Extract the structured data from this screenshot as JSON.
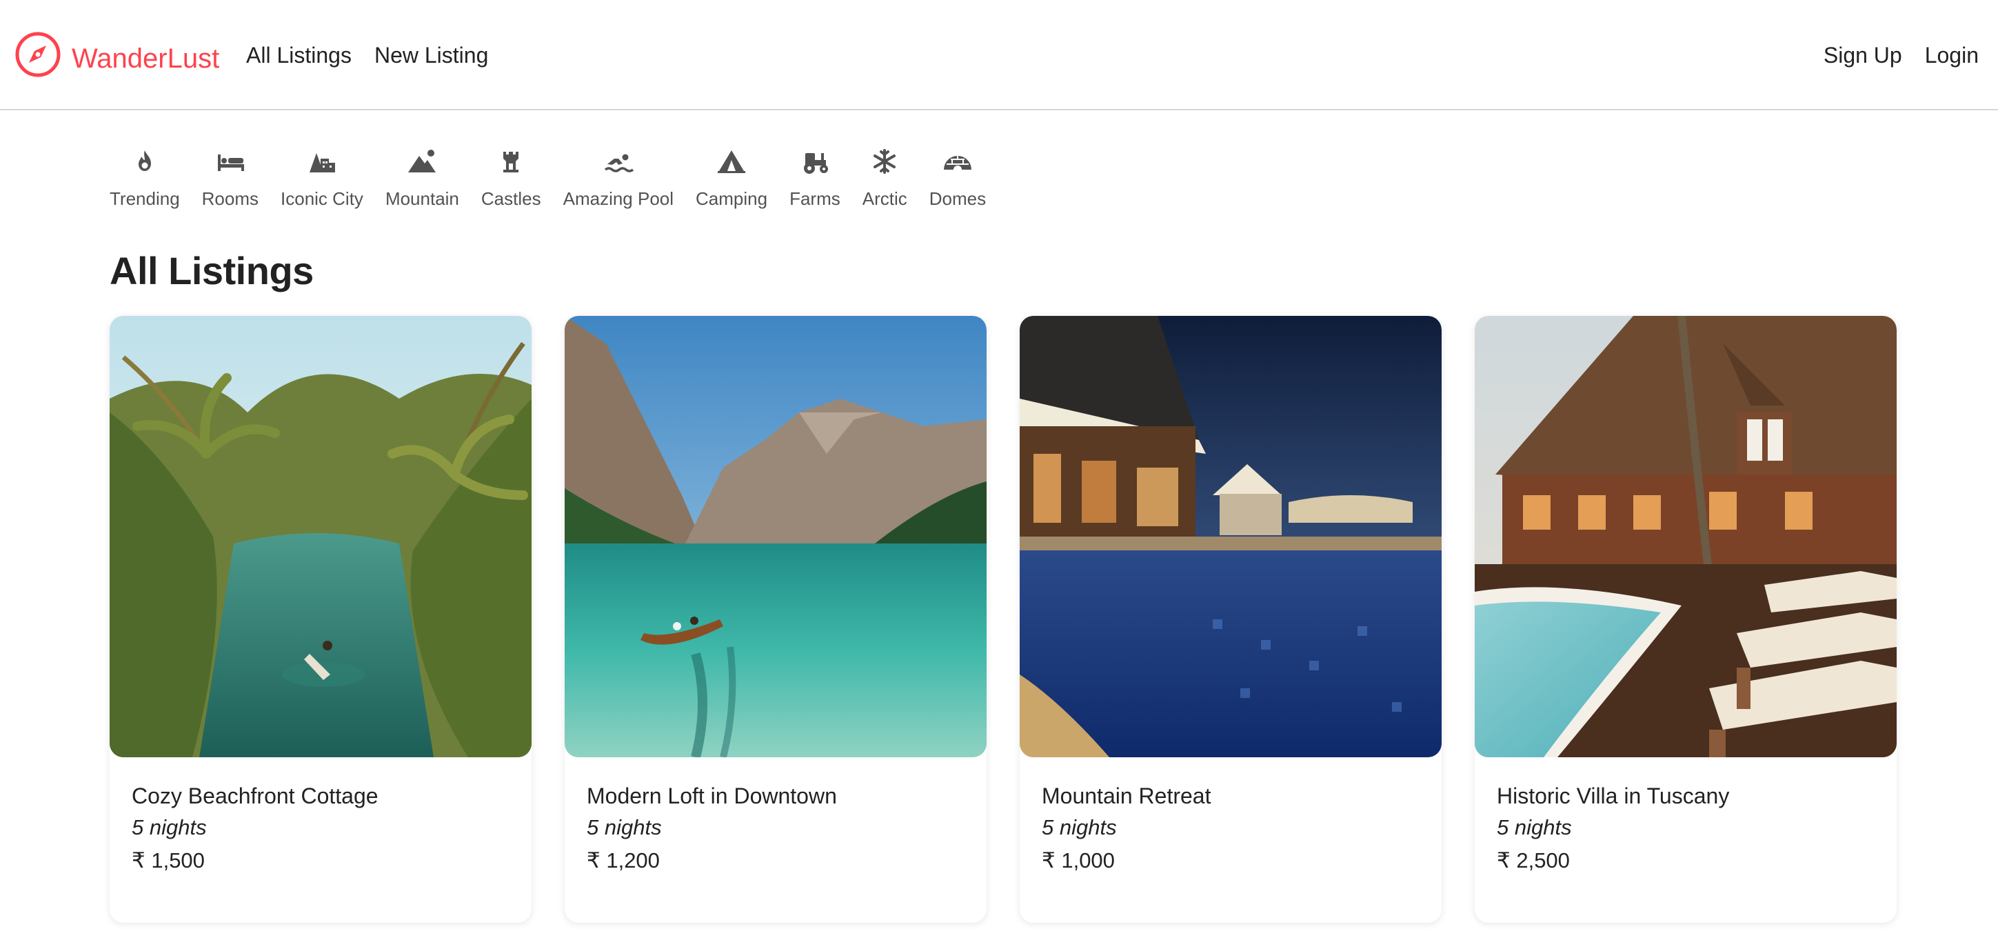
{
  "navbar": {
    "brand": "WanderLust",
    "brand_icon": "compass-icon",
    "brand_color": "#fe424d",
    "links_left": [
      {
        "label": "All Listings"
      },
      {
        "label": "New Listing"
      }
    ],
    "links_right": [
      {
        "label": "Sign Up"
      },
      {
        "label": "Login"
      }
    ]
  },
  "filters": [
    {
      "label": "Trending",
      "icon": "fire-icon"
    },
    {
      "label": "Rooms",
      "icon": "bed-icon"
    },
    {
      "label": "Iconic City",
      "icon": "city-icon"
    },
    {
      "label": "Mountain",
      "icon": "mountain-sun-icon"
    },
    {
      "label": "Castles",
      "icon": "castle-tower-icon"
    },
    {
      "label": "Amazing Pool",
      "icon": "swimmer-icon"
    },
    {
      "label": "Camping",
      "icon": "tent-icon"
    },
    {
      "label": "Farms",
      "icon": "tractor-icon"
    },
    {
      "label": "Arctic",
      "icon": "snowflake-icon"
    },
    {
      "label": "Domes",
      "icon": "igloo-icon"
    }
  ],
  "page": {
    "title": "All Listings"
  },
  "listings": [
    {
      "title": "Cozy Beachfront Cottage",
      "nights": "5 nights",
      "price": "₹ 1,500",
      "image": "tropical-lagoon-with-palms-and-boat"
    },
    {
      "title": "Modern Loft in Downtown",
      "nights": "5 nights",
      "price": "₹ 1,200",
      "image": "turquoise-mountain-lake-with-rowboat"
    },
    {
      "title": "Mountain Retreat",
      "nights": "5 nights",
      "price": "₹ 1,000",
      "image": "resort-pool-at-dusk"
    },
    {
      "title": "Historic Villa in Tuscany",
      "nights": "5 nights",
      "price": "₹ 2,500",
      "image": "wooden-lodge-with-pool-and-loungers"
    }
  ]
}
